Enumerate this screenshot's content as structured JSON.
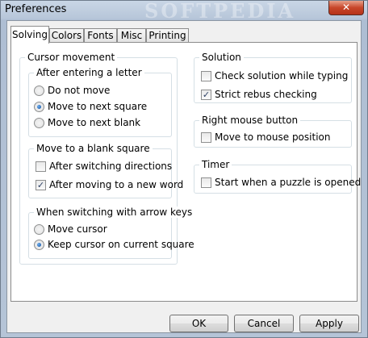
{
  "window": {
    "title": "Preferences",
    "watermark": "SOFTPEDIA",
    "close_glyph": "✕"
  },
  "tabs": [
    {
      "label": "Solving",
      "active": true
    },
    {
      "label": "Colors"
    },
    {
      "label": "Fonts"
    },
    {
      "label": "Misc"
    },
    {
      "label": "Printing"
    }
  ],
  "cursor_movement": {
    "title": "Cursor movement",
    "after_letter": {
      "title": "After entering a letter",
      "options": [
        "Do not move",
        "Move to next square",
        "Move to next blank"
      ],
      "selected": "Move to next square"
    },
    "blank_square": {
      "title": "Move to a blank square",
      "after_switching": {
        "label": "After switching directions",
        "checked": false
      },
      "after_new_word": {
        "label": "After moving to a new word",
        "checked": true
      }
    },
    "arrow_keys": {
      "title": "When switching with arrow keys",
      "options": [
        "Move cursor",
        "Keep cursor on current square"
      ],
      "selected": "Keep cursor on current square"
    }
  },
  "solution": {
    "title": "Solution",
    "check_while_typing": {
      "label": "Check solution while typing",
      "checked": false
    },
    "strict_rebus": {
      "label": "Strict rebus checking",
      "checked": true
    }
  },
  "right_mouse": {
    "title": "Right mouse button",
    "move_to_mouse": {
      "label": "Move to mouse position",
      "checked": false
    }
  },
  "timer": {
    "title": "Timer",
    "start_on_open": {
      "label": "Start when a puzzle is opened",
      "checked": false
    }
  },
  "buttons": {
    "ok": "OK",
    "cancel": "Cancel",
    "apply": "Apply"
  },
  "glyphs": {
    "check": "✓"
  }
}
